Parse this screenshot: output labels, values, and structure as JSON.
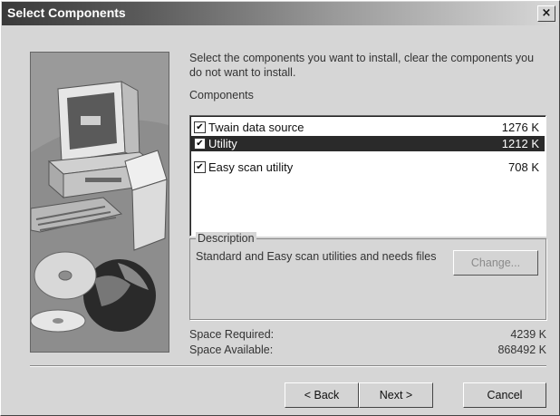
{
  "window": {
    "title": "Select Components",
    "close_glyph": "×"
  },
  "intro": "Select the components you want to install, clear the components you do not want to install.",
  "components_label": "Components",
  "components": [
    {
      "name": "Twain data source",
      "size": "1276 K",
      "checked": true,
      "selected": false
    },
    {
      "name": "Utility",
      "size": "1212 K",
      "checked": true,
      "selected": true
    },
    {
      "name": "Easy scan utility",
      "size": "708 K",
      "checked": true,
      "selected": false
    }
  ],
  "description": {
    "legend": "Description",
    "text": "Standard and Easy scan utilities  and needs files",
    "change_label": "Change..."
  },
  "space": {
    "required_label": "Space Required:",
    "required_value": "4239 K",
    "available_label": "Space Available:",
    "available_value": "868492 K"
  },
  "buttons": {
    "back": "< Back",
    "next": "Next >",
    "cancel": "Cancel"
  },
  "check_glyph": "✔",
  "icons": [
    "computer-illustration",
    "close-icon",
    "checkbox-checked-icon"
  ]
}
